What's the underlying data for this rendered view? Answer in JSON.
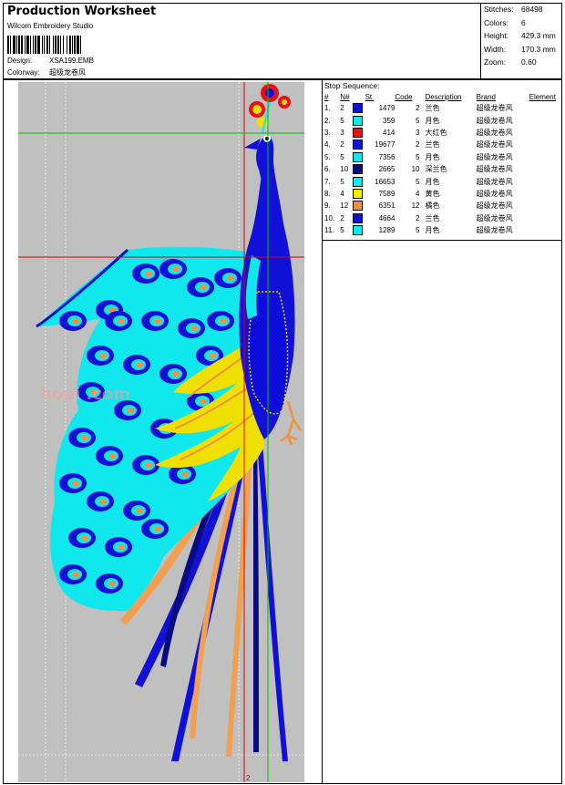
{
  "header": {
    "title": "Production Worksheet",
    "software": "Wilcom  Embroidery Studio",
    "design_label": "Design:",
    "design_value": "XSA199.EMB",
    "colorway_label": "Colorway:",
    "colorway_value": "超级龙卷风"
  },
  "stats": [
    {
      "label": "Stitches:",
      "value": "68498"
    },
    {
      "label": "Colors:",
      "value": "6"
    },
    {
      "label": "Height:",
      "value": "429.3 mm"
    },
    {
      "label": "Width:",
      "value": "170.3 mm"
    },
    {
      "label": "Zoom:",
      "value": "0.60"
    }
  ],
  "stop_sequence": {
    "title": "Stop Sequence:",
    "headers": [
      "#",
      "N#",
      "St.",
      "Code",
      "Description",
      "Brand",
      "Element"
    ],
    "rows": [
      {
        "idx": "1.",
        "n": "2",
        "color": "#1010d8",
        "st": "1479",
        "code": "2",
        "desc": "兰色",
        "brand": "超级龙卷风"
      },
      {
        "idx": "2.",
        "n": "5",
        "color": "#10e8ee",
        "st": "359",
        "code": "5",
        "desc": "月色",
        "brand": "超级龙卷风"
      },
      {
        "idx": "3.",
        "n": "3",
        "color": "#e81010",
        "st": "414",
        "code": "3",
        "desc": "大红色",
        "brand": "超级龙卷风"
      },
      {
        "idx": "4.",
        "n": "2",
        "color": "#1010d8",
        "st": "19677",
        "code": "2",
        "desc": "兰色",
        "brand": "超级龙卷风"
      },
      {
        "idx": "5.",
        "n": "5",
        "color": "#10e8ee",
        "st": "7356",
        "code": "5",
        "desc": "月色",
        "brand": "超级龙卷风"
      },
      {
        "idx": "6.",
        "n": "10",
        "color": "#0a0a80",
        "st": "2665",
        "code": "10",
        "desc": "深兰色",
        "brand": "超级龙卷风"
      },
      {
        "idx": "7.",
        "n": "5",
        "color": "#10e8ee",
        "st": "16653",
        "code": "5",
        "desc": "月色",
        "brand": "超级龙卷风"
      },
      {
        "idx": "8.",
        "n": "4",
        "color": "#f0f000",
        "st": "7589",
        "code": "4",
        "desc": "黄色",
        "brand": "超级龙卷风"
      },
      {
        "idx": "9.",
        "n": "12",
        "color": "#f09040",
        "st": "6351",
        "code": "12",
        "desc": "橘色",
        "brand": "超级龙卷风"
      },
      {
        "idx": "10.",
        "n": "2",
        "color": "#1010d8",
        "st": "4664",
        "code": "2",
        "desc": "兰色",
        "brand": "超级龙卷风"
      },
      {
        "idx": "11.",
        "n": "5",
        "color": "#10e8ee",
        "st": "1289",
        "code": "5",
        "desc": "月色",
        "brand": "超级龙卷风"
      }
    ]
  },
  "canvas": {
    "background": "#c0c0c0",
    "guide_red": "#e00000",
    "guide_green": "#00c000",
    "end_marker": "2",
    "watermark": "hopi                                   .com"
  }
}
